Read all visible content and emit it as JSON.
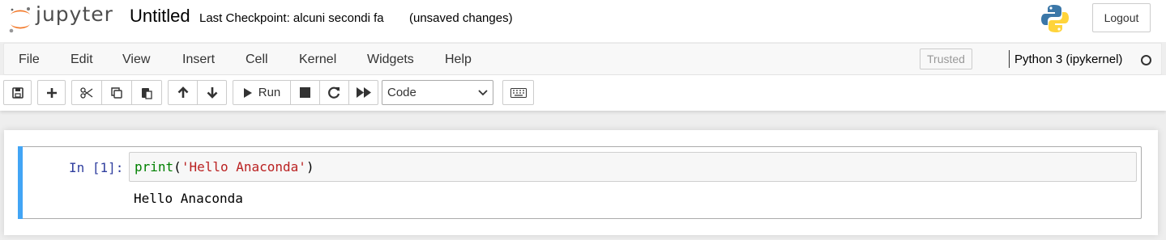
{
  "header": {
    "logo_text": "jupyter",
    "notebook_name": "Untitled",
    "checkpoint": "Last Checkpoint: alcuni secondi fa",
    "autosave_status": "(unsaved changes)",
    "logout_label": "Logout"
  },
  "menubar": {
    "items": [
      "File",
      "Edit",
      "View",
      "Insert",
      "Cell",
      "Kernel",
      "Widgets",
      "Help"
    ],
    "trusted_label": "Trusted",
    "kernel_name": "Python 3 (ipykernel)"
  },
  "toolbar": {
    "run_label": "Run",
    "cell_type": "Code"
  },
  "cell": {
    "prompt": "In [1]:",
    "code_func": "print",
    "code_open": "(",
    "code_string": "'Hello Anaconda'",
    "code_close": ")",
    "output": "Hello Anaconda"
  },
  "colors": {
    "accent": "#42a5f5",
    "prompt": "#303f9f",
    "keyword": "#008000",
    "string": "#ba2121",
    "jupyter_orange": "#f37726"
  },
  "icons": {
    "save": "floppy-icon",
    "add": "plus-icon",
    "cut": "scissors-icon",
    "copy": "copy-icon",
    "paste": "paste-icon",
    "up": "arrow-up-icon",
    "down": "arrow-down-icon",
    "run": "play-icon",
    "stop": "stop-icon",
    "restart": "restart-icon",
    "fast_forward": "fast-forward-icon",
    "keyboard": "keyboard-icon"
  }
}
